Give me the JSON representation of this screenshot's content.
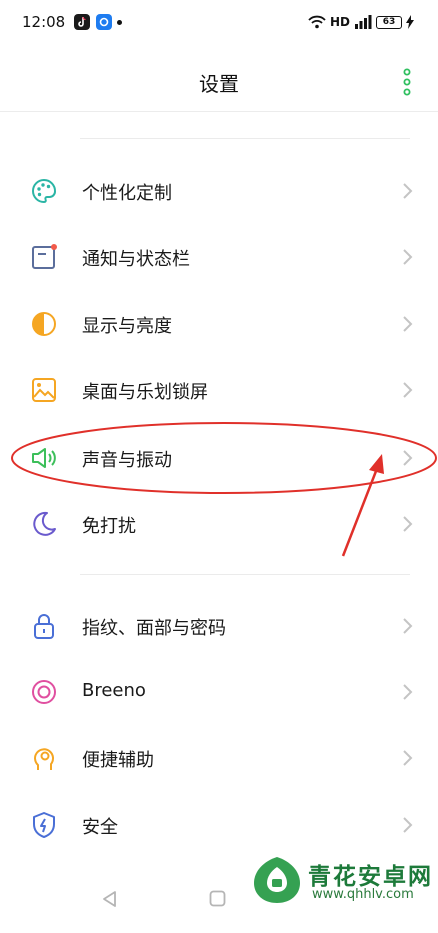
{
  "status_bar": {
    "time": "12:08",
    "network_label": "HD",
    "battery_level": "63"
  },
  "header": {
    "title": "设置"
  },
  "settings": [
    {
      "label": "个性化定制",
      "icon": "palette-icon",
      "color": "#2ab5a5"
    },
    {
      "label": "通知与状态栏",
      "icon": "notification-icon",
      "color": "#5b6e9c"
    },
    {
      "label": "显示与亮度",
      "icon": "brightness-icon",
      "color": "#f5a623"
    },
    {
      "label": "桌面与乐划锁屏",
      "icon": "wallpaper-icon",
      "color": "#f5a623"
    },
    {
      "label": "声音与振动",
      "icon": "speaker-icon",
      "color": "#3cbf5a"
    },
    {
      "label": "免打扰",
      "icon": "moon-icon",
      "color": "#6a5acd"
    },
    {
      "label": "指纹、面部与密码",
      "icon": "lock-icon",
      "color": "#4a6fd6"
    },
    {
      "label": "Breeno",
      "icon": "breeno-icon",
      "color": "#e04fa0"
    },
    {
      "label": "便捷辅助",
      "icon": "assist-icon",
      "color": "#f5a623"
    },
    {
      "label": "安全",
      "icon": "shield-icon",
      "color": "#4a6fd6"
    }
  ],
  "watermark": {
    "name": "青花安卓网",
    "url": "www.qhhlv.com"
  },
  "colors": {
    "accent_green": "#30c060",
    "annotation_red": "#e0302a",
    "chevron": "#c4c4c4",
    "divider": "#ebebeb"
  }
}
